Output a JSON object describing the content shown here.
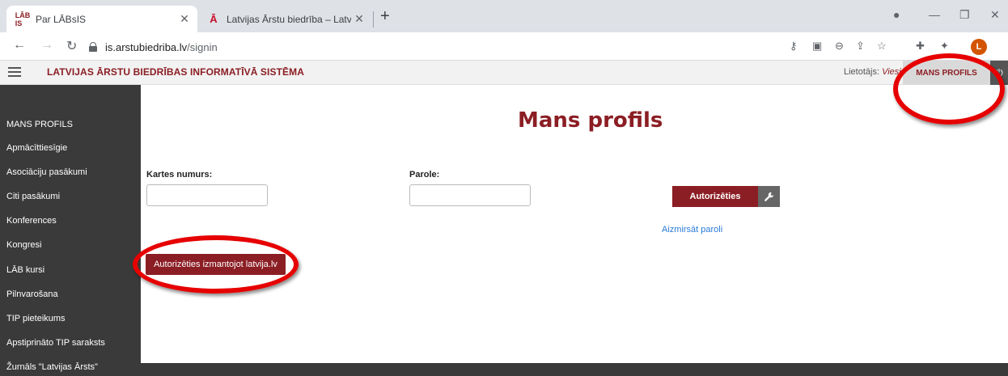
{
  "browser": {
    "tabs": [
      {
        "title": "Par LĀBsIS",
        "favicon": "LĀB IS"
      },
      {
        "title": "Latvijas Ārstu biedrība – Latvijas /",
        "favicon": "Ā"
      }
    ],
    "url_host": "is.arstubiedriba.lv",
    "url_path": "/signin",
    "profile_initial": "L"
  },
  "header": {
    "title": "LATVIJAS ĀRSTU BIEDRĪBAS INFORMATĪVĀ SISTĒMA",
    "user_prefix": "Lietotājs: ",
    "user_name": "Viesi",
    "profile_button": "MANS PROFILS"
  },
  "sidebar": {
    "items": [
      "MANS PROFILS",
      "Apmācīttiesīgie",
      "Asociāciju pasākumi",
      "Citi pasākumi",
      "Konferences",
      "Kongresi",
      "LĀB kursi",
      "Pilnvarošana",
      "TIP pieteikums",
      "Apstiprināto TIP saraksts",
      "Žurnāls \"Latvijas Ārsts\""
    ]
  },
  "main": {
    "title": "Mans profils",
    "card_label": "Kartes numurs:",
    "password_label": "Parole:",
    "auth_button": "Autorizēties",
    "forgot_link": "Aizmirsāt paroli",
    "latvija_button": "Autorizēties izmantojot latvija.lv"
  },
  "colors": {
    "brand": "#8b1e24",
    "sidebar_bg": "#3a3a3a",
    "annotation": "#e60000",
    "link": "#2a7bd6"
  }
}
